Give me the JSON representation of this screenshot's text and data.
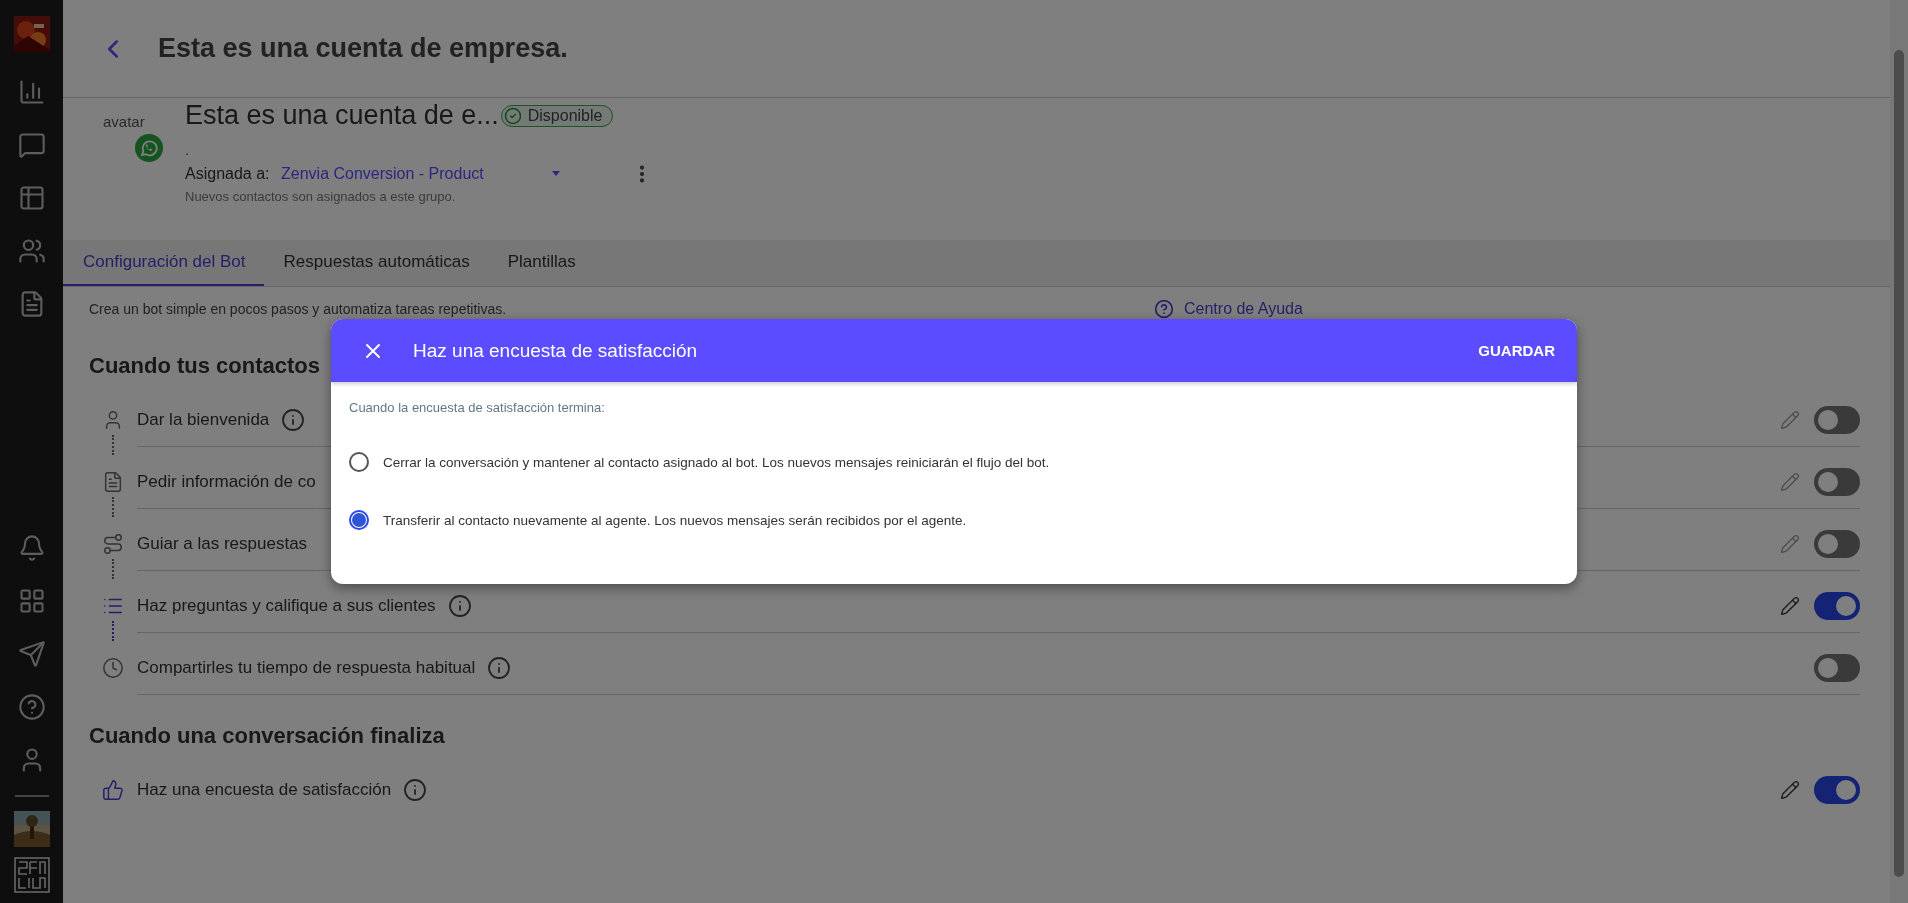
{
  "header": {
    "title": "Esta es una cuenta de empresa."
  },
  "profile": {
    "avatar_alt": "avatar",
    "name": "Esta es una cuenta de e...",
    "status": "Disponible",
    "subtitle": ".",
    "assigned_label": "Asignada a:",
    "assigned_value": "Zenvia Conversion - Product",
    "assigned_hint": "Nuevos contactos son asignados a este grupo."
  },
  "tabs": [
    {
      "label": "Configuración del Bot",
      "selected": true
    },
    {
      "label": "Respuestas automáticas",
      "selected": false
    },
    {
      "label": "Plantillas",
      "selected": false
    }
  ],
  "description": "Crea un bot simple en pocos pasos y automatiza tareas repetitivas.",
  "help_link": "Centro de Ayuda",
  "sections": [
    {
      "title": "Cuando tus contactos",
      "items": [
        {
          "kind": "user",
          "label": "Dar la bienvenida",
          "info": true,
          "editable": true,
          "on": false
        },
        {
          "kind": "form",
          "label": "Pedir información de co",
          "editable": true,
          "on": false
        },
        {
          "kind": "route",
          "label": "Guiar a las respuestas",
          "editable": true,
          "on": false
        },
        {
          "kind": "list",
          "label": "Haz preguntas y califique a sus clientes",
          "info": true,
          "editable": true,
          "on": true
        },
        {
          "kind": "clock",
          "label": "Compartirles tu tiempo de respuesta habitual",
          "info": true,
          "editable": false,
          "on": false
        }
      ]
    },
    {
      "title": "Cuando una conversación finaliza",
      "items": [
        {
          "kind": "thumbs",
          "label": "Haz una encuesta de satisfacción",
          "info": true,
          "editable": true,
          "on": true
        }
      ]
    }
  ],
  "dialog": {
    "title": "Haz una encuesta de satisfacción",
    "action": "GUARDAR",
    "prompt": "Cuando la encuesta de satisfacción termina:",
    "options": [
      {
        "label": "Cerrar la conversación y mantener al contacto asignado al bot. Los nuevos mensajes reiniciarán el flujo del bot.",
        "selected": false
      },
      {
        "label": "Transferir al contacto nuevamente al agente. Los nuevos mensajes serán recibidos por el agente.",
        "selected": true
      }
    ]
  }
}
